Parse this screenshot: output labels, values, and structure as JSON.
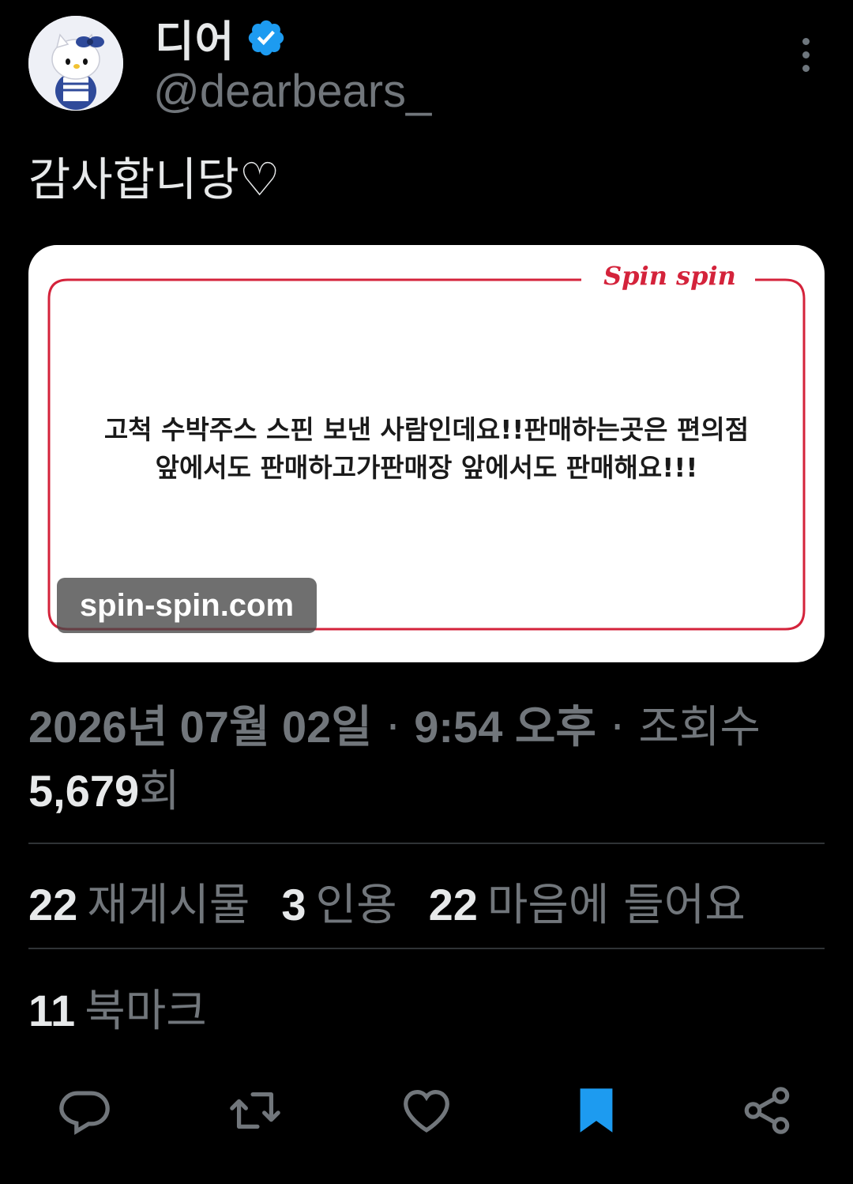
{
  "author": {
    "display_name": "디어",
    "handle": "@dearbears_",
    "verified": true
  },
  "tweet": {
    "text": "감사합니당♡",
    "card": {
      "brand": "Spin spin",
      "message_line1": "고척 수박주스 스핀 보낸 사람인데요!!판매하는곳은 편의점",
      "message_line2": "앞에서도 판매하고가판매장 앞에서도 판매해요!!!",
      "link_domain": "spin-spin.com"
    }
  },
  "meta": {
    "date": "2026년 07월 02일",
    "separator": " · ",
    "time": "9:54 오후",
    "views_label": "조회수",
    "views_count": "5,679",
    "views_suffix": "회"
  },
  "stats": {
    "reposts_count": "22",
    "reposts_label": "재게시물",
    "quotes_count": "3",
    "quotes_label": "인용",
    "likes_count": "22",
    "likes_label": "마음에 들어요",
    "bookmarks_count": "11",
    "bookmarks_label": "북마크"
  },
  "actions": [
    {
      "name": "reply-icon"
    },
    {
      "name": "repost-icon"
    },
    {
      "name": "like-icon"
    },
    {
      "name": "bookmark-icon"
    },
    {
      "name": "share-icon"
    }
  ],
  "colors": {
    "background": "#000000",
    "primary_text": "#e7e9ea",
    "secondary_text": "#71767b",
    "accent_blue": "#1d9bf0",
    "card_red": "#d4233b"
  }
}
